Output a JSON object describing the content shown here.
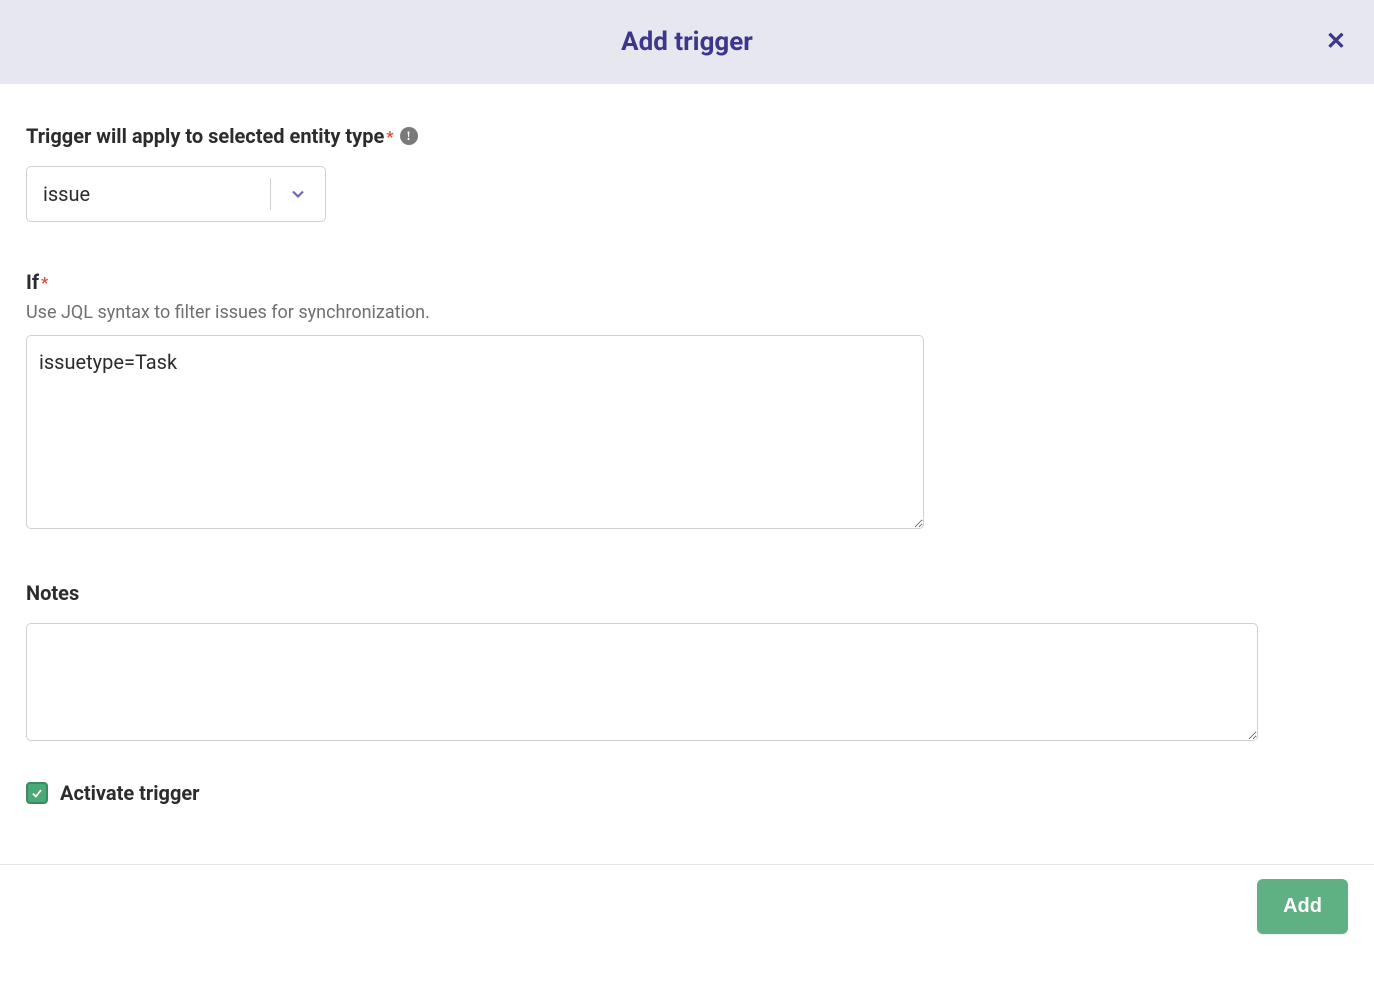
{
  "modal": {
    "title": "Add trigger"
  },
  "entityType": {
    "label": "Trigger will apply to selected entity type",
    "required_mark": "*",
    "value": "issue"
  },
  "if": {
    "label": "If",
    "required_mark": "*",
    "help": "Use JQL syntax to filter issues for synchronization.",
    "value": "issuetype=Task"
  },
  "notes": {
    "label": "Notes",
    "value": ""
  },
  "activate": {
    "label": "Activate trigger",
    "checked": true
  },
  "footer": {
    "add_label": "Add"
  }
}
